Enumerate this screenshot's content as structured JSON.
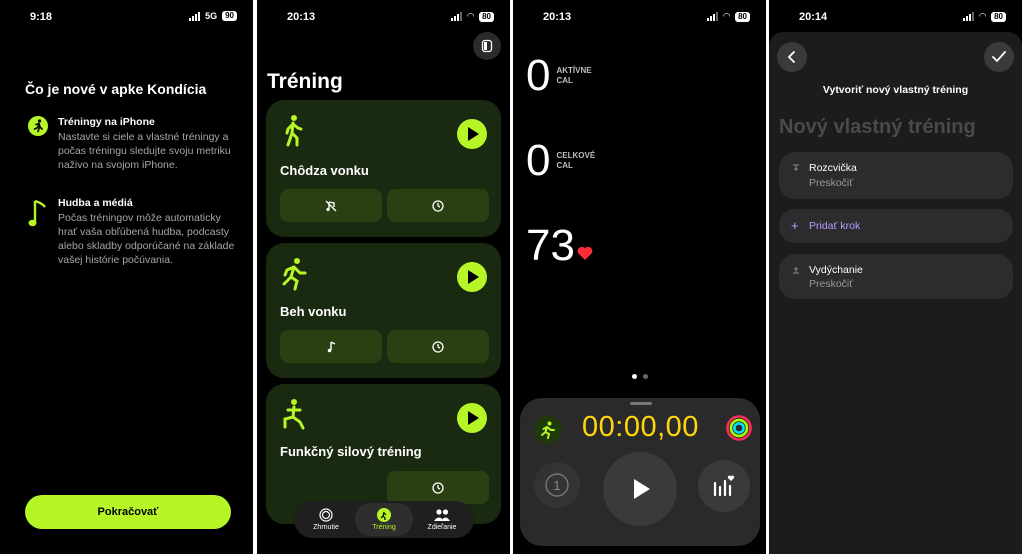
{
  "screen1": {
    "status": {
      "time": "9:18",
      "network": "5G",
      "battery": "90"
    },
    "title": "Čo je nové v apke Kondícia",
    "features": [
      {
        "icon": "running-figure-icon",
        "title": "Tréningy na iPhone",
        "text": "Nastavte si ciele a vlastné tréningy a počas tréningu sledujte svoju metriku naživo na svojom iPhone."
      },
      {
        "icon": "music-note-icon",
        "title": "Hudba a médiá",
        "text": "Počas tréningov môže automaticky hrať vaša obľúbená hudba, podcasty alebo skladby odporúčané na základe vašej histórie počúvania."
      }
    ],
    "continue_label": "Pokračovať",
    "accent": "#b6f526"
  },
  "screen2": {
    "status": {
      "time": "20:13",
      "battery": "80"
    },
    "title": "Tréning",
    "cards": [
      {
        "name": "Chôdza vonku",
        "icon": "walking-figure-icon",
        "left_icon": "no-music-icon"
      },
      {
        "name": "Beh vonku",
        "icon": "running-figure-icon",
        "left_icon": "music-note-icon"
      },
      {
        "name": "Funkčný silový tréning",
        "icon": "lunge-figure-icon",
        "left_icon": ""
      }
    ],
    "tabs": [
      {
        "label": "Zhrnutie",
        "icon": "activity-rings-icon"
      },
      {
        "label": "Tréning",
        "icon": "running-figure-icon"
      },
      {
        "label": "Zdieľanie",
        "icon": "people-icon"
      }
    ]
  },
  "screen3": {
    "status": {
      "time": "20:13",
      "battery": "80"
    },
    "active_cal": {
      "value": "0",
      "label_1": "AKTÍVNE",
      "label_2": "CAL"
    },
    "total_cal": {
      "value": "0",
      "label_1": "CELKOVÉ",
      "label_2": "CAL"
    },
    "heart_rate": "73",
    "timer": "00:00,00",
    "lap_label": "1",
    "page_count": 2,
    "current_page": 1
  },
  "screen4": {
    "status": {
      "time": "20:14",
      "battery": "80"
    },
    "header": "Vytvoriť nový vlastný tréning",
    "title_placeholder": "Nový vlastný tréning",
    "steps": [
      {
        "title": "Rozcvička",
        "sub": "Preskočiť"
      },
      {
        "title": "Vydýchanie",
        "sub": "Preskočiť"
      }
    ],
    "add_step_label": "Pridať krok",
    "add_color": "#b79cff"
  }
}
